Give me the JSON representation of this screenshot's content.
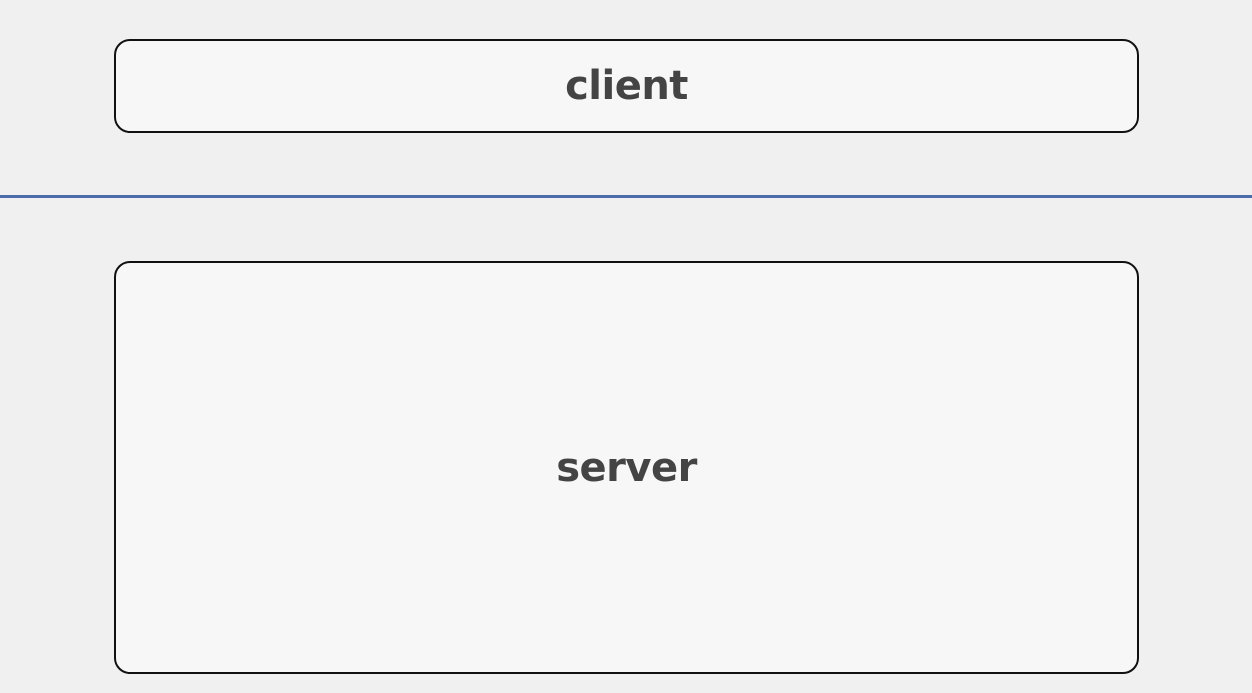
{
  "diagram": {
    "client_label": "client",
    "server_label": "server",
    "divider_color": "#4a6ca8",
    "box_fill": "#f7f7f7",
    "box_border": "#111111",
    "text_color": "#444444"
  }
}
